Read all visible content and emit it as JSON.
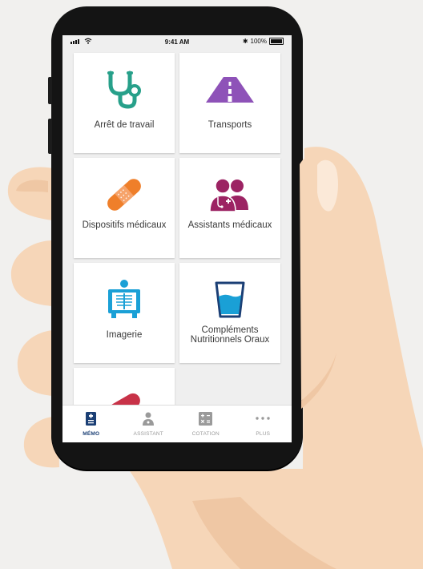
{
  "status_bar": {
    "time": "9:41 AM",
    "battery": "100%"
  },
  "tiles": [
    {
      "label": "Arrêt de travail",
      "icon": "stethoscope-icon"
    },
    {
      "label": "Transports",
      "icon": "road-icon"
    },
    {
      "label": "Dispositifs médicaux",
      "icon": "bandage-icon"
    },
    {
      "label": "Assistants médicaux",
      "icon": "medical-assistants-icon"
    },
    {
      "label": "Imagerie",
      "icon": "xray-icon"
    },
    {
      "label": "Compléments Nutritionnels Oraux",
      "icon": "glass-icon"
    },
    {
      "label": "",
      "icon": "pill-icon"
    }
  ],
  "tabs": [
    {
      "label": "MÉMO",
      "icon": "memo-icon",
      "active": true
    },
    {
      "label": "ASSISTANT",
      "icon": "assistant-icon",
      "active": false
    },
    {
      "label": "COTATION",
      "icon": "calculator-icon",
      "active": false
    },
    {
      "label": "PLUS",
      "icon": "more-icon",
      "active": false
    }
  ],
  "colors": {
    "teal": "#27a08a",
    "purple": "#8e52b8",
    "orange": "#ef7f2a",
    "magenta": "#9c2363",
    "blue": "#1aa0d6",
    "navy": "#1b3f75",
    "red": "#c83248",
    "skin": "#f6d6b8"
  }
}
